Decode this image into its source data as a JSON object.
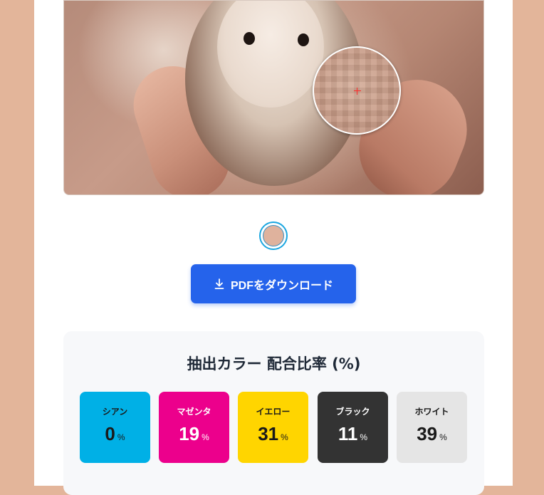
{
  "preview": {
    "picked_color": "#dfb29d",
    "crosshair_color": "#ff2a2a"
  },
  "download_button": {
    "label": "PDFをダウンロード",
    "icon": "download-icon"
  },
  "ratio": {
    "title": "抽出カラー 配合比率 (%)",
    "items": [
      {
        "label": "シアン",
        "value": "0",
        "unit": "%",
        "bg": "#00b0e6",
        "fg": "#1a1a1a"
      },
      {
        "label": "マゼンタ",
        "value": "19",
        "unit": "%",
        "bg": "#ec008c",
        "fg": "#ffffff"
      },
      {
        "label": "イエロー",
        "value": "31",
        "unit": "%",
        "bg": "#ffd500",
        "fg": "#1a1a1a"
      },
      {
        "label": "ブラック",
        "value": "11",
        "unit": "%",
        "bg": "#333333",
        "fg": "#ffffff"
      },
      {
        "label": "ホワイト",
        "value": "39",
        "unit": "%",
        "bg": "#e5e5e5",
        "fg": "#1a1a1a"
      }
    ]
  }
}
